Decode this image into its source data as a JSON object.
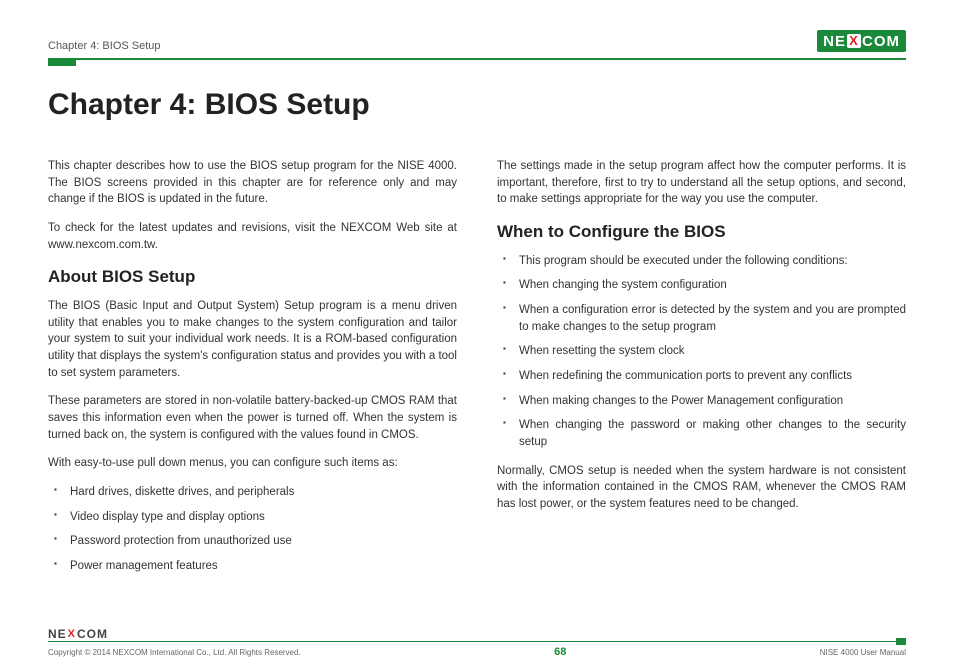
{
  "header": {
    "chapter_label": "Chapter 4: BIOS Setup",
    "logo_left": "NE",
    "logo_x": "X",
    "logo_right": "COM"
  },
  "title": "Chapter 4: BIOS Setup",
  "left_col": {
    "p1": "This chapter describes how to use the BIOS setup program for the NISE 4000. The BIOS screens provided in this chapter are for reference only and may change if the BIOS is updated in the future.",
    "p2": "To check for the latest updates and revisions, visit the NEXCOM Web site at www.nexcom.com.tw.",
    "h_about": "About BIOS Setup",
    "p3": "The BIOS (Basic Input and Output System) Setup program is a menu driven utility that enables you to make changes to the system configuration and tailor your system to suit your individual work needs. It is a ROM-based configuration utility that displays the system's configuration status and provides you with a tool to set system parameters.",
    "p4": "These parameters are stored in non-volatile battery-backed-up CMOS RAM that saves this information even when the power is turned off. When the system is turned back on, the system is configured with the values found in CMOS.",
    "p5": "With easy-to-use pull down menus, you can configure such items as:",
    "items": [
      "Hard drives, diskette drives, and peripherals",
      "Video display type and display options",
      "Password protection from unauthorized use",
      "Power management features"
    ]
  },
  "right_col": {
    "p1": "The settings made in the setup program affect how the computer performs. It is important, therefore, first to try to understand all the setup options, and second, to make settings appropriate for the way you use the computer.",
    "h_when": "When to Configure the BIOS",
    "items": [
      "This program should be executed under the following conditions:",
      "When changing the system configuration",
      "When a configuration error is detected by the system and you are prompted to make changes to the setup program",
      "When resetting the system clock",
      "When redefining the communication ports to prevent any conflicts",
      "When making changes to the Power Management configuration",
      "When changing the password or making other changes to the security setup"
    ],
    "p2": "Normally, CMOS setup is needed when the system hardware is not consistent with the information contained in the CMOS RAM, whenever the CMOS RAM has lost power, or the system features need to be changed."
  },
  "footer": {
    "logo_left": "NE",
    "logo_x": "X",
    "logo_right": "COM",
    "copyright": "Copyright © 2014 NEXCOM International Co., Ltd. All Rights Reserved.",
    "page": "68",
    "doc": "NISE 4000 User Manual"
  }
}
